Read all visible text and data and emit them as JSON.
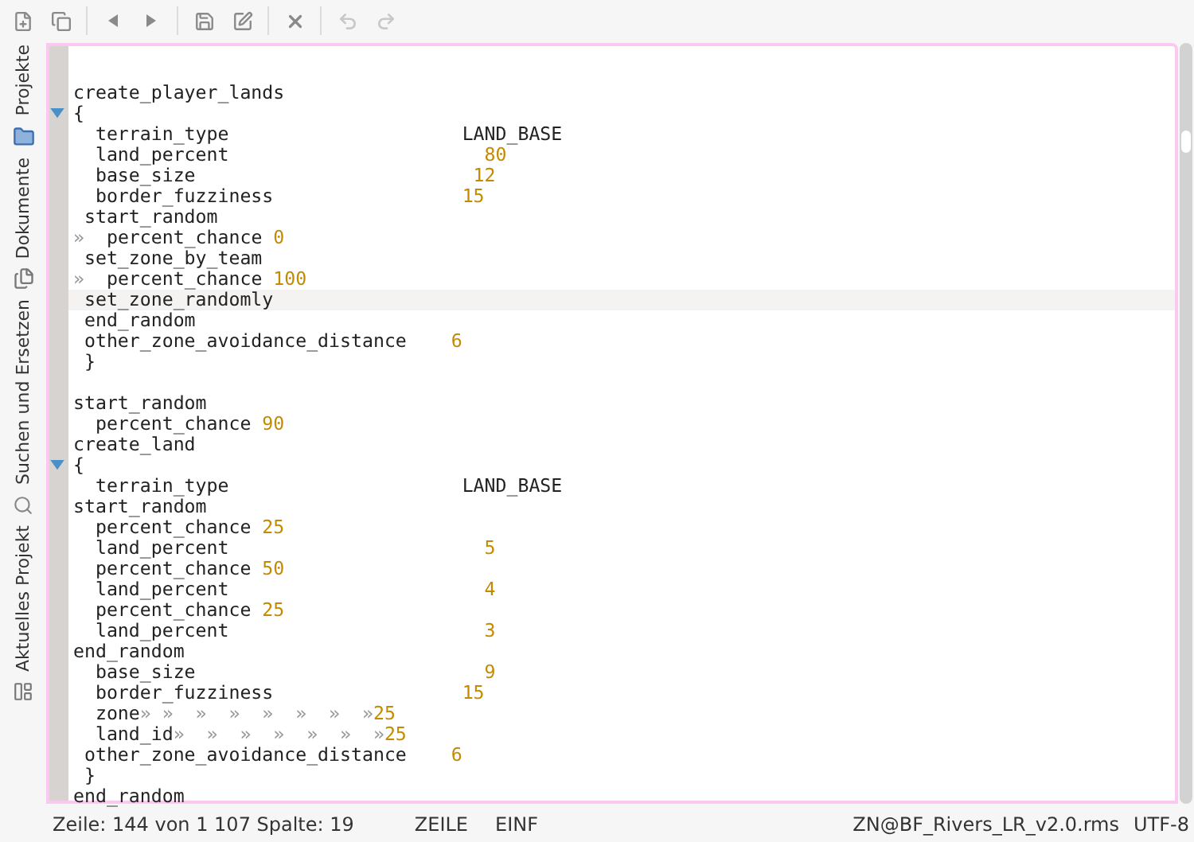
{
  "toolbar": [
    {
      "kind": "new",
      "disabled": false
    },
    {
      "kind": "copy",
      "disabled": false
    },
    {
      "kind": "back",
      "disabled": false
    },
    {
      "kind": "forward",
      "disabled": false
    },
    {
      "kind": "save",
      "disabled": false
    },
    {
      "kind": "save-as",
      "disabled": false
    },
    {
      "kind": "close",
      "disabled": false
    },
    {
      "kind": "undo",
      "disabled": true
    },
    {
      "kind": "redo",
      "disabled": true
    }
  ],
  "side_tabs": [
    {
      "label": "Projekte"
    },
    {
      "label": "Dokumente"
    },
    {
      "label": "Suchen und Ersetzen"
    },
    {
      "label": "Aktuelles Projekt"
    }
  ],
  "editor": {
    "lines": [
      {
        "kind": "blank"
      },
      {
        "code": "create_player_lands"
      },
      {
        "code": "{",
        "fold": true
      },
      {
        "code": "  terrain_type                     ",
        "value": "LAND_BASE",
        "kind": "word"
      },
      {
        "code": "  land_percent                       ",
        "value": "80",
        "kind": "number"
      },
      {
        "code": "  base_size                         ",
        "value": "12",
        "kind": "number"
      },
      {
        "code": "  border_fuzziness                 ",
        "value": "15",
        "kind": "number"
      },
      {
        "code": " start_random"
      },
      {
        "lead": "»",
        "code": "  percent_chance ",
        "value": "0",
        "kind": "number"
      },
      {
        "code": " set_zone_by_team"
      },
      {
        "lead": "»",
        "code": "  percent_chance ",
        "value": "100",
        "kind": "number"
      },
      {
        "code": " set_zone_randomly",
        "current": true
      },
      {
        "code": " end_random"
      },
      {
        "code": " other_zone_avoidance_distance    ",
        "value": "6",
        "kind": "number"
      },
      {
        "code": " }"
      },
      {
        "kind": "blank"
      },
      {
        "code": "start_random"
      },
      {
        "code": "  percent_chance ",
        "value": "90",
        "kind": "number"
      },
      {
        "code": "create_land"
      },
      {
        "code": "{",
        "fold": true
      },
      {
        "code": "  terrain_type                     ",
        "value": "LAND_BASE",
        "kind": "word"
      },
      {
        "code": "start_random"
      },
      {
        "code": "  percent_chance ",
        "value": "25",
        "kind": "number"
      },
      {
        "code": "  land_percent                       ",
        "value": "5",
        "kind": "number"
      },
      {
        "code": "  percent_chance ",
        "value": "50",
        "kind": "number"
      },
      {
        "code": "  land_percent                       ",
        "value": "4",
        "kind": "number"
      },
      {
        "code": "  percent_chance ",
        "value": "25",
        "kind": "number"
      },
      {
        "code": "  land_percent                       ",
        "value": "3",
        "kind": "number"
      },
      {
        "code": "end_random"
      },
      {
        "code": "  base_size                          ",
        "value": "9",
        "kind": "number"
      },
      {
        "code": "  border_fuzziness                 ",
        "value": "15",
        "kind": "number"
      },
      {
        "code": "  zone",
        "tabs": "» »  »  »  »  »  »  »",
        "value": "25",
        "kind": "number"
      },
      {
        "code": "  land_id",
        "tabs": "»  »  »  »  »  »  »",
        "value": "25",
        "kind": "number"
      },
      {
        "code": " other_zone_avoidance_distance    ",
        "value": "6",
        "kind": "number"
      },
      {
        "code": " }"
      },
      {
        "code": "end_random"
      }
    ]
  },
  "status_bar": {
    "position": "Zeile: 144 von 1 107 Spalte: 19",
    "mode": "ZEILE",
    "insert": "EINF",
    "file": "ZN@BF_Rivers_LR_v2.0.rms",
    "encoding": "UTF-8"
  }
}
